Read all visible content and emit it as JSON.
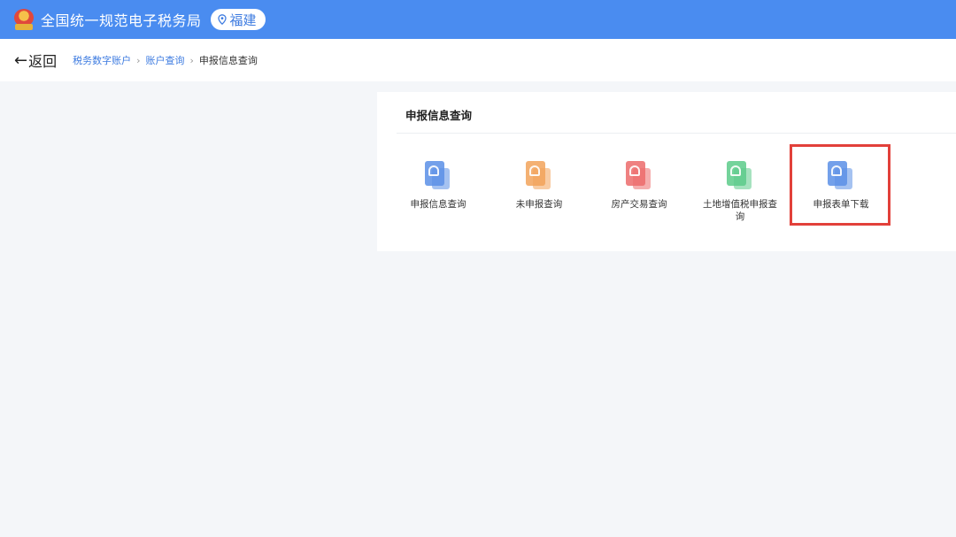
{
  "header": {
    "site_title": "全国统一规范电子税务局",
    "region": "福建",
    "colors": {
      "bar": "#4a8cf0",
      "accent": "#3d7be0"
    }
  },
  "nav": {
    "back_label": "返回",
    "breadcrumb": [
      "税务数字账户",
      "账户查询",
      "申报信息查询"
    ]
  },
  "card": {
    "title": "申报信息查询",
    "items": [
      {
        "label": "申报信息查询",
        "icon": "document-lock-icon",
        "color": "#5b8fe6"
      },
      {
        "label": "未申报查询",
        "icon": "document-lock-icon",
        "color": "#f2a35a"
      },
      {
        "label": "房产交易查询",
        "icon": "document-lock-icon",
        "color": "#ec6b6b"
      },
      {
        "label": "土地增值税申报查询",
        "icon": "document-lock-icon",
        "color": "#5ccb8a"
      },
      {
        "label": "申报表单下载",
        "icon": "document-lock-icon",
        "color": "#5b8fe6",
        "highlighted": true
      }
    ]
  }
}
